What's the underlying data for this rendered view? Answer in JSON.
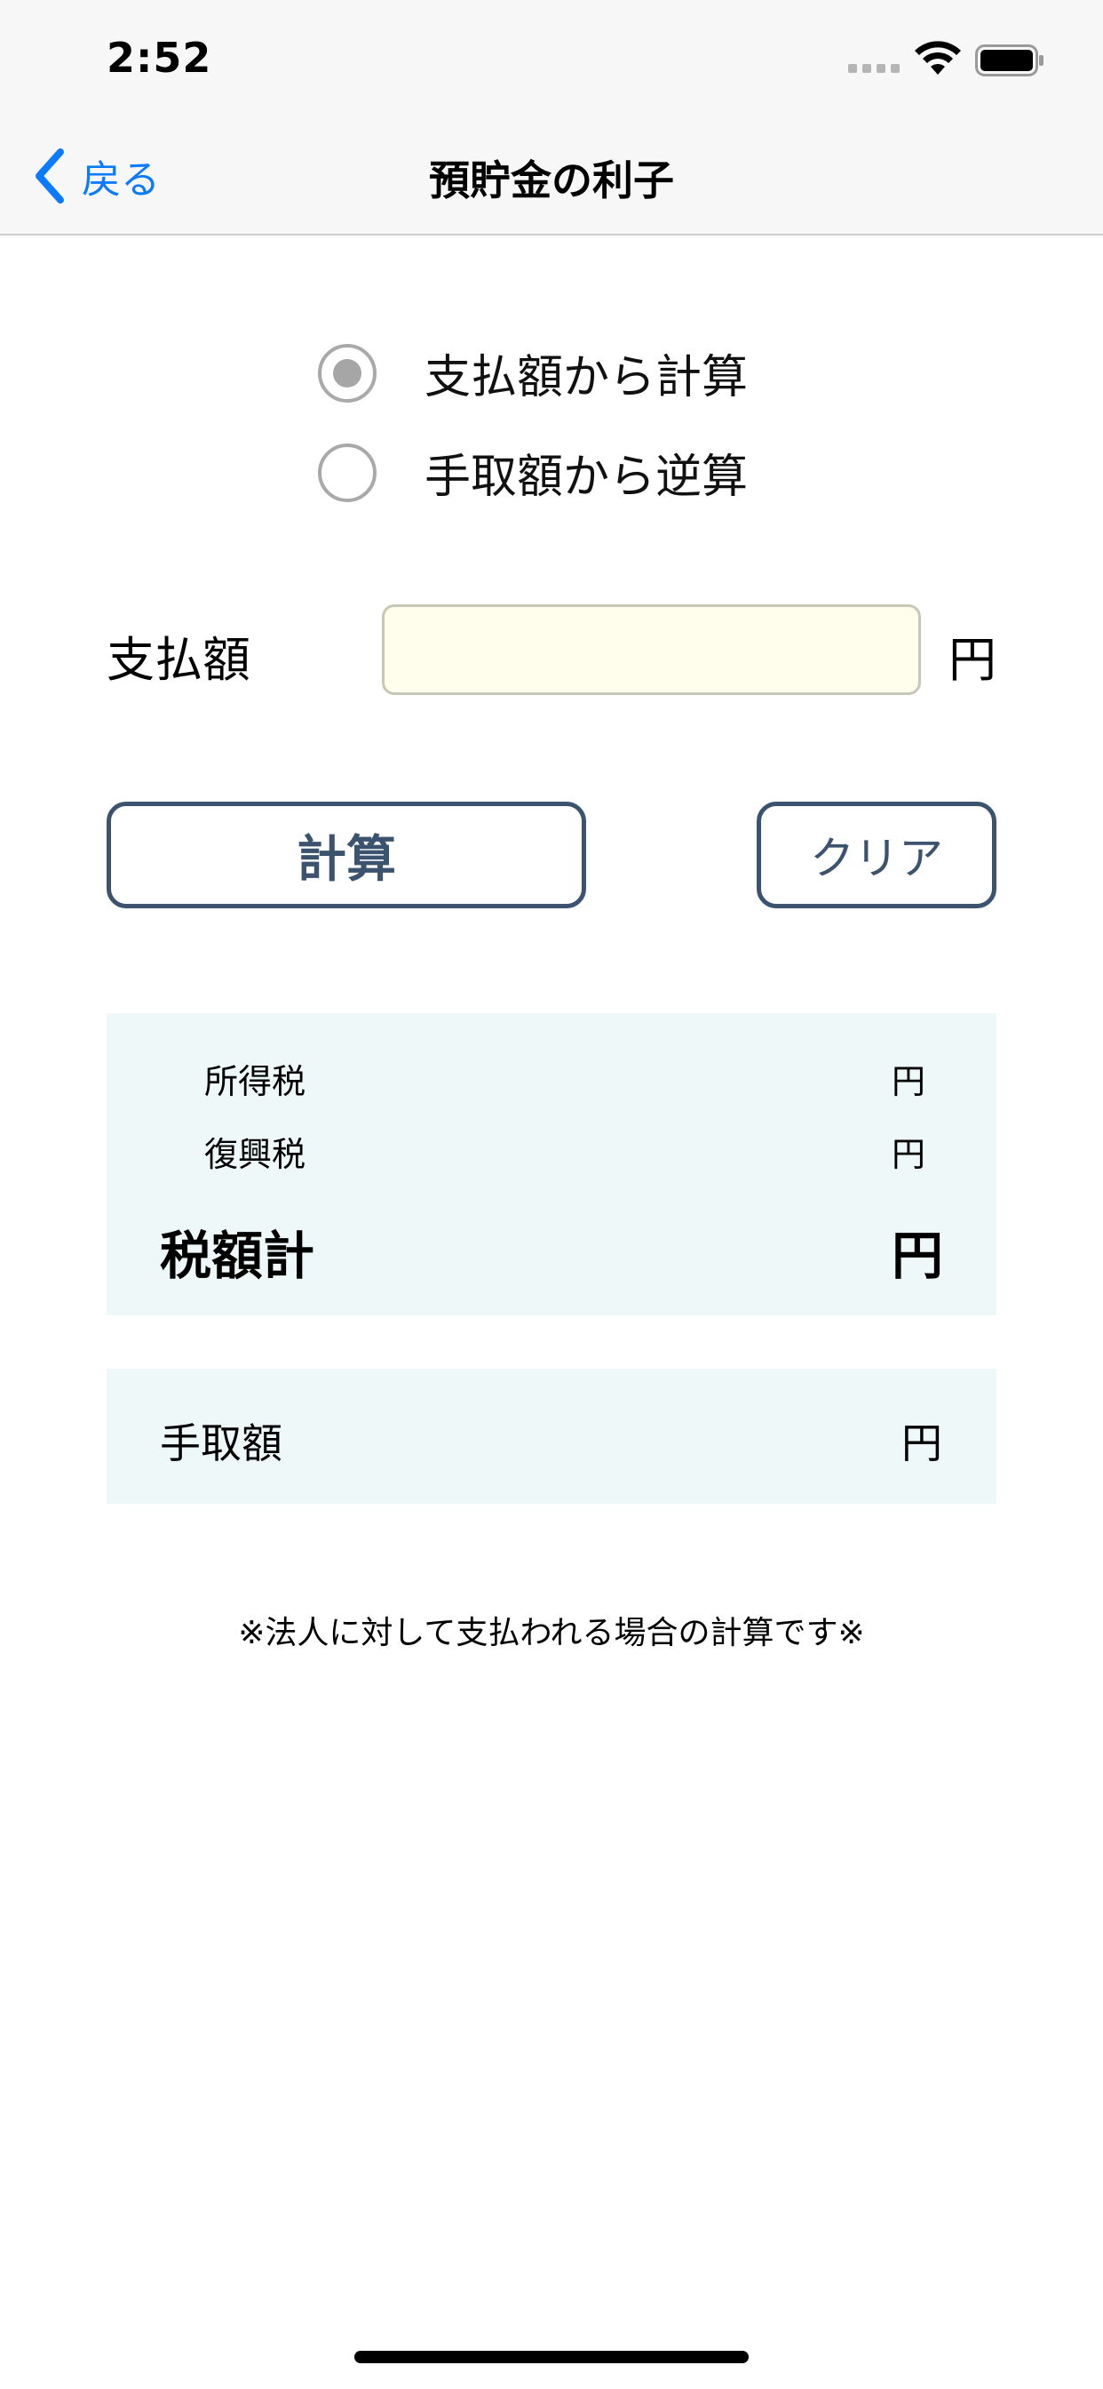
{
  "status_bar": {
    "time": "2:52",
    "icons": [
      "cellular-signal-icon",
      "wifi-icon",
      "battery-icon"
    ]
  },
  "nav": {
    "back_label": "戻る",
    "title": "預貯金の利子"
  },
  "mode": {
    "options": [
      {
        "label": "支払額から計算",
        "selected": true
      },
      {
        "label": "手取額から逆算",
        "selected": false
      }
    ]
  },
  "input": {
    "label": "支払額",
    "value": "",
    "placeholder": "",
    "unit": "円"
  },
  "buttons": {
    "calculate": "計算",
    "clear": "クリア"
  },
  "results": {
    "income_tax": {
      "label": "所得税",
      "unit": "円"
    },
    "reconstruction_tax": {
      "label": "復興税",
      "unit": "円"
    },
    "total_tax": {
      "label": "税額計",
      "unit": "円"
    },
    "net_amount": {
      "label": "手取額",
      "unit": "円"
    }
  },
  "note": "※法人に対して支払われる場合の計算です※",
  "colors": {
    "accent_blue": "#0a7aff",
    "button_border": "#3b536e",
    "input_background": "#fffdeb",
    "panel_background": "#eff8f8"
  }
}
